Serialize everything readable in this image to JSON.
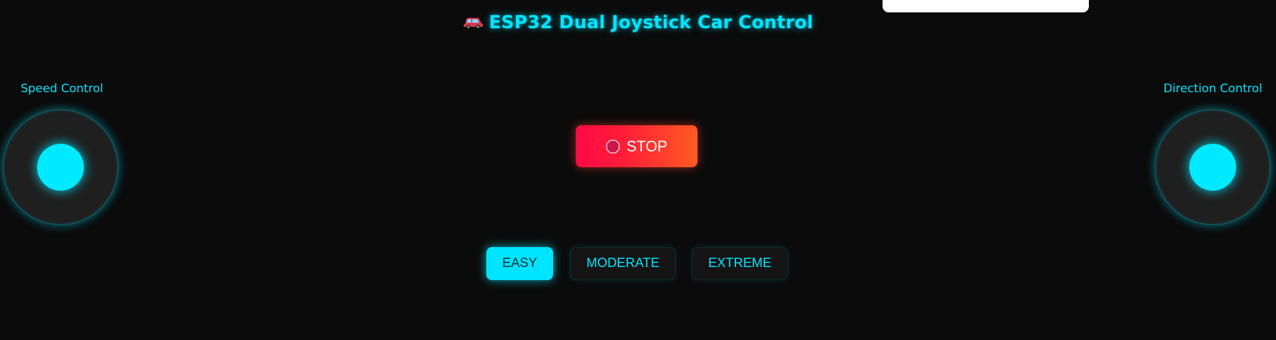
{
  "header": {
    "icon": "car-icon",
    "title": "ESP32 Dual Joystick Car Control"
  },
  "left_joystick": {
    "label": "Speed Control"
  },
  "right_joystick": {
    "label": "Direction Control"
  },
  "stop_button": {
    "icon": "stop-sign-icon",
    "label": "STOP"
  },
  "modes": {
    "selected": "EASY",
    "easy_label": "EASY",
    "moderate_label": "MODERATE",
    "extreme_label": "EXTREME"
  },
  "colors": {
    "background": "#0b0b0b",
    "accent": "#00e5ff",
    "stop_gradient_start": "#ff0a45",
    "stop_gradient_end": "#ff5a22"
  }
}
